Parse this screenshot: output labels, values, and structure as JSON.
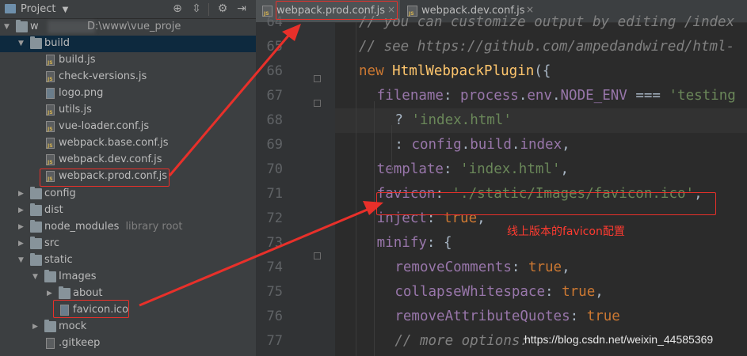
{
  "project_panel": {
    "title": "Project",
    "root_label": "w",
    "root_path": "D:\\www\\vue_proje",
    "tree": [
      {
        "label": "build",
        "type": "folder",
        "open": true,
        "depth": 1,
        "selected": true
      },
      {
        "label": "build.js",
        "type": "js",
        "depth": 2
      },
      {
        "label": "check-versions.js",
        "type": "js",
        "depth": 2
      },
      {
        "label": "logo.png",
        "type": "img",
        "depth": 2
      },
      {
        "label": "utils.js",
        "type": "js",
        "depth": 2
      },
      {
        "label": "vue-loader.conf.js",
        "type": "js",
        "depth": 2
      },
      {
        "label": "webpack.base.conf.js",
        "type": "js",
        "depth": 2
      },
      {
        "label": "webpack.dev.conf.js",
        "type": "js",
        "depth": 2
      },
      {
        "label": "webpack.prod.conf.js",
        "type": "js",
        "depth": 2
      },
      {
        "label": "config",
        "type": "folder",
        "open": false,
        "depth": 1
      },
      {
        "label": "dist",
        "type": "folder",
        "open": false,
        "depth": 1
      },
      {
        "label": "node_modules",
        "type": "folder",
        "open": false,
        "depth": 1,
        "hint": "library root"
      },
      {
        "label": "src",
        "type": "folder",
        "open": false,
        "depth": 1
      },
      {
        "label": "static",
        "type": "folder",
        "open": true,
        "depth": 1
      },
      {
        "label": "Images",
        "type": "folder",
        "open": true,
        "depth": 2
      },
      {
        "label": "about",
        "type": "folder",
        "open": false,
        "depth": 3
      },
      {
        "label": "favicon.ico",
        "type": "img",
        "depth": 3
      },
      {
        "label": "mock",
        "type": "folder",
        "open": false,
        "depth": 2
      },
      {
        "label": ".gitkeep",
        "type": "file",
        "depth": 2
      }
    ]
  },
  "tabs": [
    {
      "label": "webpack.prod.conf.js",
      "active": true
    },
    {
      "label": "webpack.dev.conf.js",
      "active": false
    }
  ],
  "editor": {
    "current_line": 68,
    "lines": [
      {
        "n": "64",
        "indent": 1,
        "tokens": [
          [
            "cmt",
            "// you can customize output by editing /index"
          ]
        ]
      },
      {
        "n": "65",
        "indent": 1,
        "tokens": [
          [
            "cmt",
            "// see https://github.com/ampedandwired/html-"
          ]
        ]
      },
      {
        "n": "66",
        "indent": 1,
        "tokens": [
          [
            "kw",
            "new "
          ],
          [
            "fn",
            "HtmlWebpackPlugin"
          ],
          [
            "plain",
            "({"
          ]
        ]
      },
      {
        "n": "67",
        "indent": 2,
        "tokens": [
          [
            "key",
            "filename"
          ],
          [
            "plain",
            ": "
          ],
          [
            "prop",
            "process"
          ],
          [
            "plain",
            "."
          ],
          [
            "prop",
            "env"
          ],
          [
            "plain",
            "."
          ],
          [
            "prop",
            "NODE_ENV"
          ],
          [
            "plain",
            " === "
          ],
          [
            "str",
            "'testing"
          ]
        ]
      },
      {
        "n": "68",
        "indent": 3,
        "tokens": [
          [
            "plain",
            "? "
          ],
          [
            "str",
            "'index.html'"
          ]
        ]
      },
      {
        "n": "69",
        "indent": 3,
        "tokens": [
          [
            "plain",
            ": "
          ],
          [
            "key",
            "config"
          ],
          [
            "plain",
            "."
          ],
          [
            "key",
            "build"
          ],
          [
            "plain",
            "."
          ],
          [
            "key",
            "index"
          ],
          [
            "plain",
            ","
          ]
        ]
      },
      {
        "n": "70",
        "indent": 2,
        "tokens": [
          [
            "key",
            "template"
          ],
          [
            "plain",
            ": "
          ],
          [
            "str",
            "'index.html'"
          ],
          [
            "plain",
            ","
          ]
        ]
      },
      {
        "n": "71",
        "indent": 2,
        "tokens": [
          [
            "key",
            "favicon"
          ],
          [
            "plain",
            ": "
          ],
          [
            "str",
            "'./static/Images/favicon.ico'"
          ],
          [
            "plain",
            ","
          ]
        ]
      },
      {
        "n": "72",
        "indent": 2,
        "tokens": [
          [
            "key",
            "inject"
          ],
          [
            "plain",
            ": "
          ],
          [
            "kw",
            "true"
          ],
          [
            "plain",
            ","
          ]
        ]
      },
      {
        "n": "73",
        "indent": 2,
        "tokens": [
          [
            "key",
            "minify"
          ],
          [
            "plain",
            ": {"
          ]
        ]
      },
      {
        "n": "74",
        "indent": 3,
        "tokens": [
          [
            "key",
            "removeComments"
          ],
          [
            "plain",
            ": "
          ],
          [
            "kw",
            "true"
          ],
          [
            "plain",
            ","
          ]
        ]
      },
      {
        "n": "75",
        "indent": 3,
        "tokens": [
          [
            "key",
            "collapseWhitespace"
          ],
          [
            "plain",
            ": "
          ],
          [
            "kw",
            "true"
          ],
          [
            "plain",
            ","
          ]
        ]
      },
      {
        "n": "76",
        "indent": 3,
        "tokens": [
          [
            "key",
            "removeAttributeQuotes"
          ],
          [
            "plain",
            ": "
          ],
          [
            "kw",
            "true"
          ]
        ]
      },
      {
        "n": "77",
        "indent": 3,
        "tokens": [
          [
            "cmt",
            "// more options:"
          ]
        ]
      }
    ]
  },
  "annotation": {
    "note": "线上版本的favicon配置",
    "color": "#e8302a"
  },
  "watermark": "https://blog.csdn.net/weixin_44585369",
  "colors": {
    "panel_bg": "#3c3f41",
    "editor_bg": "#2b2b2b",
    "gutter_bg": "#313335",
    "selection": "#0d293e"
  }
}
